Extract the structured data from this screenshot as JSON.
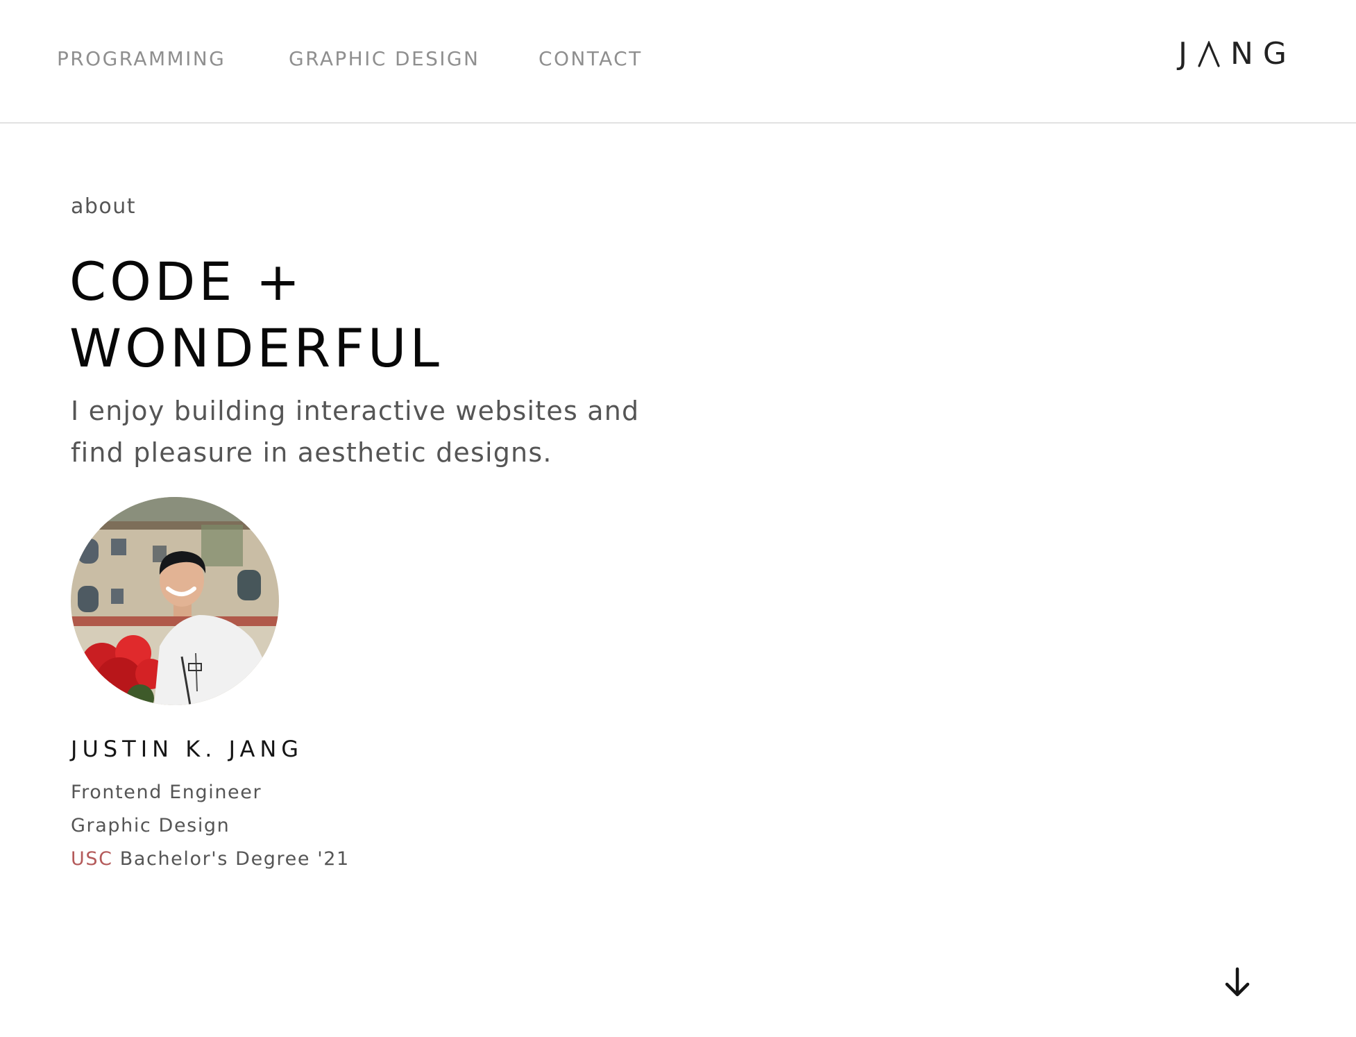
{
  "nav": {
    "links": [
      {
        "label": "PROGRAMMING"
      },
      {
        "label": "GRAPHIC DESIGN"
      },
      {
        "label": "CONTACT"
      }
    ],
    "logo": {
      "pre": "J",
      "post": "NG"
    }
  },
  "about": {
    "label": "about",
    "headline": {
      "line1": "CODE +",
      "line2": "WONDERFUL"
    },
    "intro": "I enjoy building interactive websites and find pleasure in aesthetic designs."
  },
  "profile": {
    "name": "JUSTIN K. JANG",
    "details": [
      {
        "text": "Frontend Engineer"
      },
      {
        "text": "Graphic Design"
      }
    ],
    "education": {
      "school": "USC",
      "degree": " Bachelor's Degree '21"
    },
    "accent_color": "#b45a5a"
  },
  "scroll": {
    "icon": "arrow-down-icon"
  }
}
